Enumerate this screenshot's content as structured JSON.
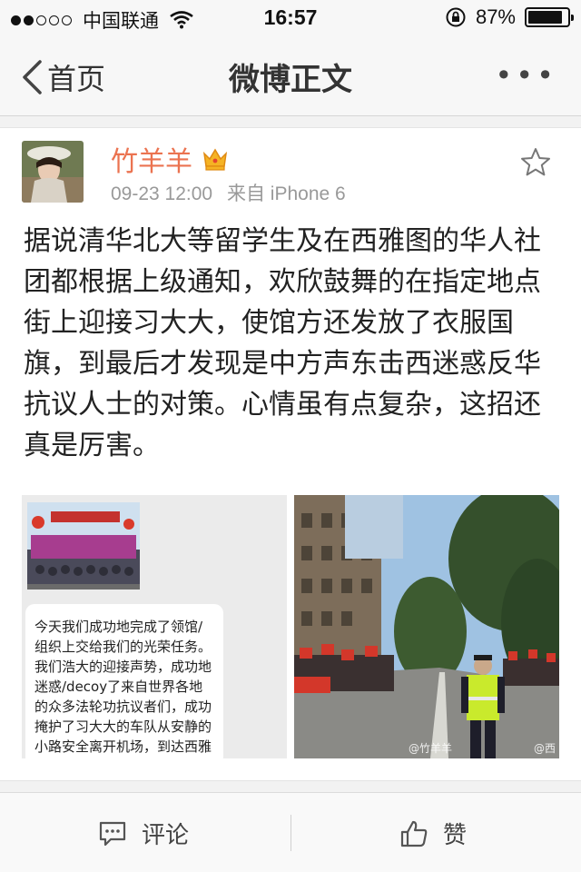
{
  "status_bar": {
    "carrier": "中国联通",
    "time": "16:57",
    "battery_percent": "87%",
    "battery_level": 0.87,
    "signal_bars_filled": 2,
    "signal_bars_total": 5
  },
  "nav": {
    "back_label": "首页",
    "title": "微博正文",
    "more_label": "•••"
  },
  "post": {
    "username": "竹羊羊",
    "time": "09-23 12:00",
    "source": "来自 iPhone 6",
    "text": "据说清华北大等留学生及在西雅图的华人社团都根据上级通知，欢欣鼓舞的在指定地点街上迎接习大大，使馆方还发放了衣服国旗，到最后才发现是中方声东击西迷惑反华抗议人士的对策。心情虽有点复杂，这招还真是厉害。",
    "accent_color": "#eb7350"
  },
  "images": {
    "left_chat_text": "今天我们成功地完成了领馆/组织上交给我们的光荣任务。我们浩大的迎接声势，成功地迷惑/decoy了来自世界各地的众多法轮功抗议者们，成功掩护了习大大的车队从安静的小路安全离开机场，到达西雅图市区接受那里群众们的热烈欢迎",
    "left_emoji": "😂😂",
    "right_watermark_1": "@竹羊羊",
    "right_watermark_2": "@西雅"
  },
  "toolbar": {
    "comment_label": "评论",
    "like_label": "赞"
  }
}
